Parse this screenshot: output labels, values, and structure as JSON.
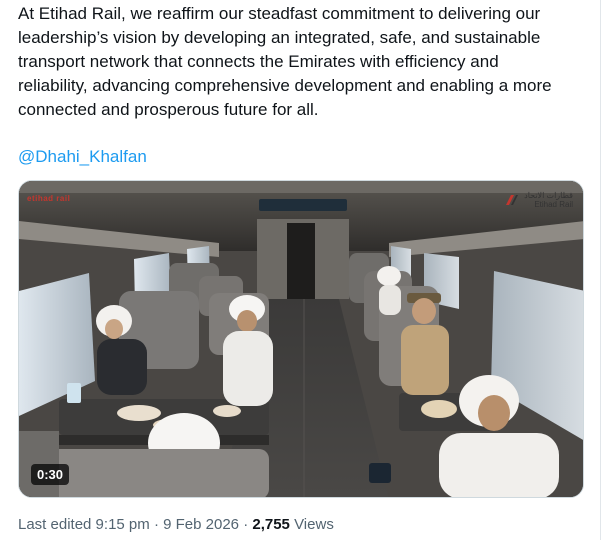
{
  "tweet": {
    "text": "At Etihad Rail, we reaffirm our steadfast commitment to delivering our\nleadership’s vision by developing an integrated, safe, and sustainable\ntransport network that connects the Emirates with efficiency and\nreliability, advancing comprehensive development and enabling a more\nconnected and prosperous future for all.",
    "mention": "@Dhahi_Khalfan"
  },
  "media": {
    "duration": "0:30",
    "brand_left": "etihad rail",
    "brand_right_arabic": "قطارات الاتحاد",
    "brand_right_english": "Etihad Rail"
  },
  "meta": {
    "edited": "Last edited 9:15 pm",
    "sep1": "·",
    "date": "9 Feb 2026",
    "sep2": "·",
    "views_count": "2,755",
    "views_label": "Views"
  },
  "colors": {
    "link": "#1d9bf0",
    "secondary_text": "#536471",
    "primary_text": "#0f1419"
  }
}
